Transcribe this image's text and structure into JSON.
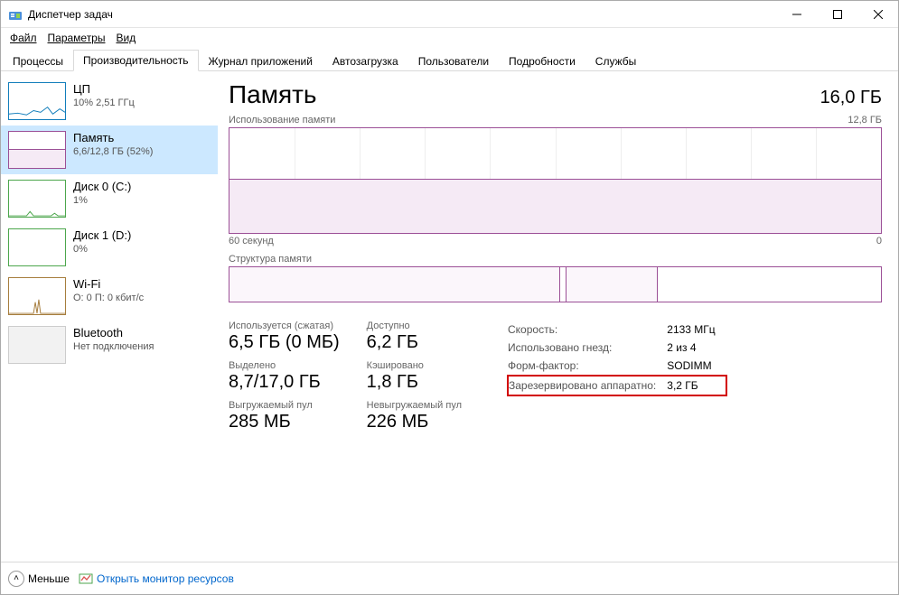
{
  "window": {
    "title": "Диспетчер задач"
  },
  "menu": {
    "file": "Файл",
    "options": "Параметры",
    "view": "Вид"
  },
  "tabs": {
    "processes": "Процессы",
    "performance": "Производительность",
    "apphistory": "Журнал приложений",
    "startup": "Автозагрузка",
    "users": "Пользователи",
    "details": "Подробности",
    "services": "Службы"
  },
  "sidebar": {
    "cpu": {
      "title": "ЦП",
      "sub": "10% 2,51 ГГц"
    },
    "mem": {
      "title": "Память",
      "sub": "6,6/12,8 ГБ (52%)"
    },
    "disk0": {
      "title": "Диск 0 (C:)",
      "sub": "1%"
    },
    "disk1": {
      "title": "Диск 1 (D:)",
      "sub": "0%"
    },
    "wifi": {
      "title": "Wi-Fi",
      "sub": "О: 0 П: 0 кбит/с"
    },
    "bt": {
      "title": "Bluetooth",
      "sub": "Нет подключения"
    }
  },
  "main": {
    "title": "Память",
    "total": "16,0 ГБ",
    "usage_label": "Использование памяти",
    "usage_max": "12,8 ГБ",
    "time_label": "60 секунд",
    "time_zero": "0",
    "comp_label": "Структура памяти"
  },
  "stats": {
    "inuse_label": "Используется (сжатая)",
    "inuse_value": "6,5 ГБ (0 МБ)",
    "avail_label": "Доступно",
    "avail_value": "6,2 ГБ",
    "commit_label": "Выделено",
    "commit_value": "8,7/17,0 ГБ",
    "cached_label": "Кэшировано",
    "cached_value": "1,8 ГБ",
    "paged_label": "Выгружаемый пул",
    "paged_value": "285 МБ",
    "nonpaged_label": "Невыгружаемый пул",
    "nonpaged_value": "226 МБ"
  },
  "right": {
    "speed_label": "Скорость:",
    "speed_value": "2133 МГц",
    "slots_label": "Использовано гнезд:",
    "slots_value": "2 из 4",
    "form_label": "Форм-фактор:",
    "form_value": "SODIMM",
    "reserved_label": "Зарезервировано аппаратно:",
    "reserved_value": "3,2 ГБ"
  },
  "footer": {
    "less": "Меньше",
    "resmon": "Открыть монитор ресурсов"
  },
  "chart_data": {
    "type": "line",
    "title": "Использование памяти",
    "xlabel": "60 секунд → 0",
    "ylabel": "ГБ",
    "ylim": [
      0,
      12.8
    ],
    "series": [
      {
        "name": "Память",
        "values": [
          6.6,
          6.6,
          6.6,
          6.6,
          6.6,
          6.6,
          6.6,
          6.6,
          6.6,
          6.6,
          6.6,
          6.6,
          6.6,
          6.6,
          6.6,
          6.6,
          6.6,
          6.6,
          6.6,
          6.6
        ]
      }
    ],
    "composition": {
      "in_use_gb": 6.5,
      "standby_gb": 1.8,
      "free_gb": 4.5,
      "total_gb": 12.8
    }
  }
}
